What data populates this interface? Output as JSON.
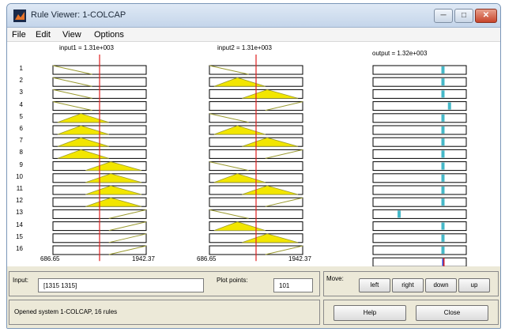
{
  "window": {
    "title": "Rule Viewer: 1-COLCAP",
    "min_label": "─",
    "max_label": "□",
    "close_label": "✕"
  },
  "menu": [
    "File",
    "Edit",
    "View",
    "Options"
  ],
  "plots": {
    "input1_title": "input1 = 1.31e+003",
    "input2_title": "input2 = 1.31e+003",
    "output_title": "output = 1.32e+003",
    "axis_min": "686.65",
    "axis_max": "1942.37"
  },
  "rules": {
    "numbers": [
      "1",
      "2",
      "3",
      "4",
      "5",
      "6",
      "7",
      "8",
      "9",
      "10",
      "11",
      "12",
      "13",
      "14",
      "15",
      "16"
    ],
    "input1_mf": [
      "Z",
      "Z",
      "Z",
      "Z",
      "M",
      "M",
      "M",
      "M",
      "L",
      "L",
      "L",
      "L",
      "H",
      "H",
      "H",
      "H"
    ],
    "input2_mf": [
      "Z",
      "M",
      "L",
      "H",
      "Z",
      "M",
      "L",
      "H",
      "Z",
      "M",
      "L",
      "H",
      "Z",
      "M",
      "L",
      "H"
    ],
    "output_level": [
      0.75,
      0.75,
      0.75,
      0.82,
      0.75,
      0.75,
      0.75,
      0.75,
      0.75,
      0.75,
      0.75,
      0.75,
      0.28,
      0.75,
      0.75,
      0.75
    ]
  },
  "controls": {
    "input_label": "Input:",
    "input_value": "[1315 1315]",
    "plot_points_label": "Plot points:",
    "plot_points_value": "101",
    "move_label": "Move:",
    "left": "left",
    "right": "right",
    "down": "down",
    "up": "up",
    "status": "Opened system 1-COLCAP, 16 rules",
    "help": "Help",
    "close": "Close"
  },
  "colors": {
    "cursor": "#e02020",
    "fill": "#f2e600",
    "curve": "#9b9b30",
    "output_marker": "#45b8c8"
  }
}
